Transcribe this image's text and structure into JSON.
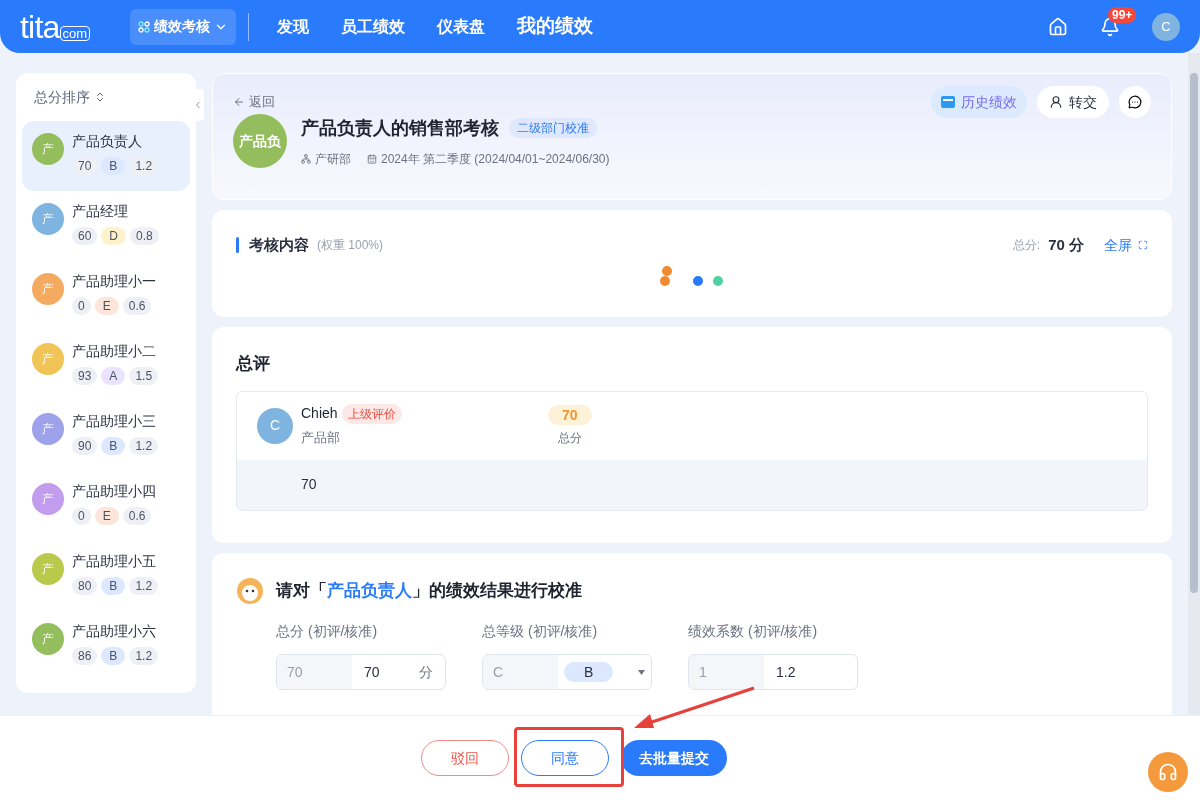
{
  "header": {
    "logo_text": "tita",
    "logo_suffix": "com",
    "module": "绩效考核",
    "nav": [
      {
        "label": "发现",
        "selected": false
      },
      {
        "label": "员工绩效",
        "selected": false
      },
      {
        "label": "仪表盘",
        "selected": false
      },
      {
        "label": "我的绩效",
        "selected": true
      }
    ],
    "badge": "99+",
    "avatar": "C"
  },
  "sidebar": {
    "sort_label": "总分排序",
    "items": [
      {
        "avatar": {
          "text": "产",
          "color": "#94bd5e"
        },
        "name": "产品负责人",
        "score": "70",
        "grade": {
          "text": "B",
          "color": "#dbe8ff"
        },
        "coef": "1.2",
        "selected": true
      },
      {
        "avatar": {
          "text": "产",
          "color": "#7fb3e0"
        },
        "name": "产品经理",
        "score": "60",
        "grade": {
          "text": "D",
          "color": "#fdf2cc"
        },
        "coef": "0.8",
        "selected": false
      },
      {
        "avatar": {
          "text": "产",
          "color": "#f5aa62"
        },
        "name": "产品助理小一",
        "score": "0",
        "grade": {
          "text": "E",
          "color": "#fde6d9"
        },
        "coef": "0.6",
        "selected": false
      },
      {
        "avatar": {
          "text": "产",
          "color": "#f0c456"
        },
        "name": "产品助理小二",
        "score": "93",
        "grade": {
          "text": "A",
          "color": "#ebe3fd"
        },
        "coef": "1.5",
        "selected": false
      },
      {
        "avatar": {
          "text": "产",
          "color": "#9da2eb"
        },
        "name": "产品助理小三",
        "score": "90",
        "grade": {
          "text": "B",
          "color": "#dbe8ff"
        },
        "coef": "1.2",
        "selected": false
      },
      {
        "avatar": {
          "text": "产",
          "color": "#c39ded"
        },
        "name": "产品助理小四",
        "score": "0",
        "grade": {
          "text": "E",
          "color": "#fde6d9"
        },
        "coef": "0.6",
        "selected": false
      },
      {
        "avatar": {
          "text": "产",
          "color": "#b8c94c"
        },
        "name": "产品助理小五",
        "score": "80",
        "grade": {
          "text": "B",
          "color": "#dbe8ff"
        },
        "coef": "1.2",
        "selected": false
      },
      {
        "avatar": {
          "text": "产",
          "color": "#94bd5e"
        },
        "name": "产品助理小六",
        "score": "86",
        "grade": {
          "text": "B",
          "color": "#dbe8ff"
        },
        "coef": "1.2",
        "selected": false
      }
    ]
  },
  "profile": {
    "back": "返回",
    "history": "历史绩效",
    "transfer": "转交",
    "avatar": "产品负",
    "title": "产品负责人的销售部考核",
    "tag": "二级部门校准",
    "dept": "产研部",
    "period": "2024年 第二季度 (2024/04/01~2024/06/30)"
  },
  "content": {
    "title": "考核内容",
    "weight": "(权重 100%)",
    "total_label": "总分:",
    "total": "70 分",
    "fullscreen": "全屏"
  },
  "review": {
    "title": "总评",
    "reviewer": "Chieh",
    "avatar": "C",
    "role": "上级评价",
    "dept": "产品部",
    "score": "70",
    "score_label": "总分",
    "comment": "70"
  },
  "calibration": {
    "prefix": "请对「",
    "name": "产品负责人",
    "suffix": "」的绩效结果进行校准",
    "fields": [
      {
        "kind": "score",
        "label": "总分 (初评/核准)",
        "initial": "70",
        "value": "70",
        "unit": "分"
      },
      {
        "kind": "grade",
        "label": "总等级 (初评/核准)",
        "initial": "C",
        "value": "B"
      },
      {
        "kind": "coef",
        "label": "绩效系数 (初评/核准)",
        "initial": "1",
        "value": "1.2"
      }
    ]
  },
  "footer": {
    "buttons": [
      {
        "kind": "reject",
        "label": "驳回"
      },
      {
        "kind": "agree",
        "label": "同意"
      },
      {
        "kind": "submit",
        "label": "去批量提交"
      }
    ]
  }
}
